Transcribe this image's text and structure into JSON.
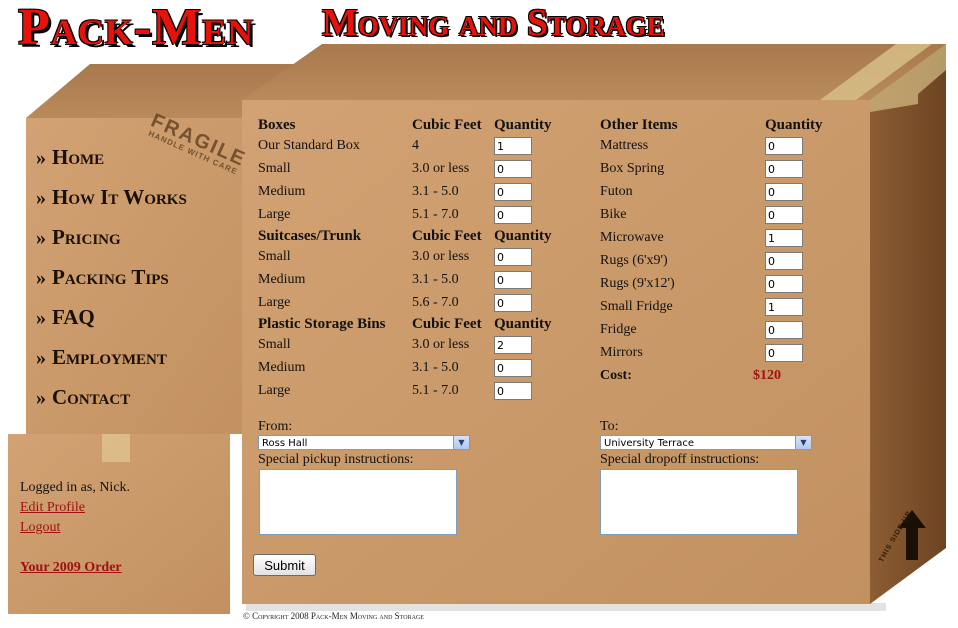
{
  "header": {
    "logo": "Pack-Men",
    "tagline": "Moving and Storage"
  },
  "colors": {
    "brand_red": "#e8120c",
    "box_face": "#c8986a",
    "box_side": "#8a5a32",
    "link_red": "#a01010"
  },
  "nav": {
    "chevron": "»",
    "items": [
      {
        "label": "Home"
      },
      {
        "label": "How It Works"
      },
      {
        "label": "Pricing"
      },
      {
        "label": "Packing Tips"
      },
      {
        "label": "FAQ"
      },
      {
        "label": "Employment"
      },
      {
        "label": "Contact"
      }
    ]
  },
  "stamp": {
    "line1": "FRAGILE",
    "line2": "HANDLE WITH CARE"
  },
  "login": {
    "status": "Logged in as, Nick.",
    "edit_profile": "Edit Profile",
    "logout": "Logout",
    "order": "Your 2009 Order"
  },
  "boxes_section": {
    "header": "Boxes",
    "cubic_header": "Cubic Feet",
    "qty_header": "Quantity",
    "rows": [
      {
        "label": "Our Standard Box",
        "cubic": "4",
        "qty": "1"
      },
      {
        "label": "Small",
        "cubic": "3.0 or less",
        "qty": "0"
      },
      {
        "label": "Medium",
        "cubic": "3.1 - 5.0",
        "qty": "0"
      },
      {
        "label": "Large",
        "cubic": "5.1 - 7.0",
        "qty": "0"
      }
    ]
  },
  "suitcases_section": {
    "header": "Suitcases/Trunk",
    "cubic_header": "Cubic Feet",
    "qty_header": "Quantity",
    "rows": [
      {
        "label": "Small",
        "cubic": "3.0 or less",
        "qty": "0"
      },
      {
        "label": "Medium",
        "cubic": "3.1 - 5.0",
        "qty": "0"
      },
      {
        "label": "Large",
        "cubic": "5.6 - 7.0",
        "qty": "0"
      }
    ]
  },
  "bins_section": {
    "header": "Plastic Storage Bins",
    "cubic_header": "Cubic Feet",
    "qty_header": "Quantity",
    "rows": [
      {
        "label": "Small",
        "cubic": "3.0 or less",
        "qty": "2"
      },
      {
        "label": "Medium",
        "cubic": "3.1 - 5.0",
        "qty": "0"
      },
      {
        "label": "Large",
        "cubic": "5.1 - 7.0",
        "qty": "0"
      }
    ]
  },
  "other_section": {
    "header": "Other Items",
    "qty_header": "Quantity",
    "rows": [
      {
        "label": "Mattress",
        "qty": "0"
      },
      {
        "label": "Box Spring",
        "qty": "0"
      },
      {
        "label": "Futon",
        "qty": "0"
      },
      {
        "label": "Bike",
        "qty": "0"
      },
      {
        "label": "Microwave",
        "qty": "1"
      },
      {
        "label": "Rugs (6'x9')",
        "qty": "0"
      },
      {
        "label": "Rugs (9'x12')",
        "qty": "0"
      },
      {
        "label": "Small Fridge",
        "qty": "1"
      },
      {
        "label": "Fridge",
        "qty": "0"
      },
      {
        "label": "Mirrors",
        "qty": "0"
      }
    ],
    "cost_label": "Cost:",
    "cost_value": "$120"
  },
  "from": {
    "label": "From:",
    "selected": "Ross Hall",
    "instructions_label": "Special pickup instructions:",
    "instructions_value": ""
  },
  "to": {
    "label": "To:",
    "selected": "University Terrace",
    "instructions_label": "Special dropoff instructions:",
    "instructions_value": ""
  },
  "submit_label": "Submit",
  "copyright": "© Copyright 2008 Pack-Men Moving and Storage",
  "side_label": "THIS SIDE UP"
}
